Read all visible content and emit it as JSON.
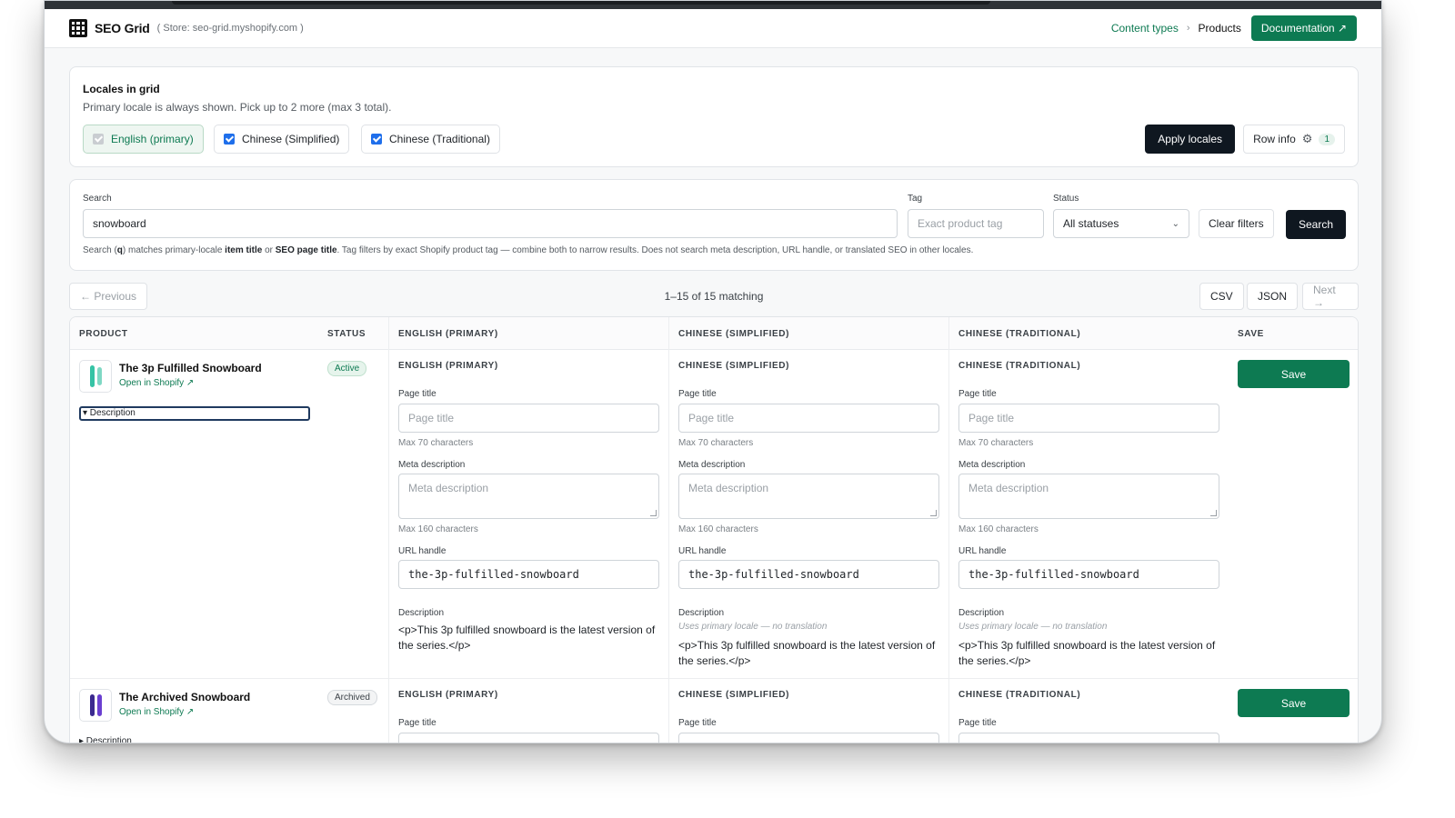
{
  "header": {
    "brand": "SEO Grid",
    "store": "( Store: seo-grid.myshopify.com )",
    "breadcrumb": {
      "link": "Content types",
      "separator": "›",
      "current": "Products"
    },
    "doc_button": "Documentation ↗"
  },
  "locales": {
    "title": "Locales in grid",
    "subtitle": "Primary locale is always shown. Pick up to 2 more (max 3 total).",
    "options": [
      {
        "label": "English (primary)",
        "checked": true,
        "disabled": true
      },
      {
        "label": "Chinese (Simplified)",
        "checked": true,
        "disabled": false
      },
      {
        "label": "Chinese (Traditional)",
        "checked": true,
        "disabled": false
      }
    ],
    "apply_button": "Apply locales",
    "row_info_button": "Row info",
    "row_info_count": "1"
  },
  "search": {
    "search_label": "Search",
    "search_value": "snowboard",
    "tag_label": "Tag",
    "tag_placeholder": "Exact product tag",
    "status_label": "Status",
    "status_value": "All statuses",
    "clear_button": "Clear filters",
    "search_button": "Search",
    "help_1": "Search (",
    "help_q": "q",
    "help_2": ") matches primary-locale ",
    "help_item_title": "item title",
    "help_3": " or ",
    "help_seo_title": "SEO page title",
    "help_4": ". Tag filters by exact Shopify product tag — combine both to narrow results. Does not search meta description, URL handle, or translated SEO in other locales."
  },
  "pager": {
    "previous": "← Previous",
    "summary": "1–15 of 15 matching",
    "csv": "CSV",
    "json": "JSON",
    "next": "Next →"
  },
  "table": {
    "headers": {
      "product": "PRODUCT",
      "status": "STATUS",
      "en": "ENGLISH (PRIMARY)",
      "zh_cn": "CHINESE (SIMPLIFIED)",
      "zh_tw": "CHINESE (TRADITIONAL)",
      "save": "SAVE"
    },
    "field_labels": {
      "page_title": "Page title",
      "page_title_placeholder": "Page title",
      "page_title_hint": "Max 70 characters",
      "meta_description": "Meta description",
      "meta_placeholder": "Meta description",
      "meta_hint": "Max 160 characters",
      "url_handle": "URL handle",
      "description": "Description",
      "fallback_note": "Uses primary locale — no translation"
    },
    "rows": [
      {
        "name": "The 3p Fulfilled Snowboard",
        "open_link": "Open in Shopify ↗",
        "status": "Active",
        "details_label": "▾ Description",
        "handle": "the-3p-fulfilled-snowboard",
        "description": "<p>This 3p fulfilled snowboard is the latest version of the series.</p>",
        "save": "Save"
      },
      {
        "name": "The Archived Snowboard",
        "open_link": "Open in Shopify ↗",
        "status": "Archived",
        "details_label": "▸ Description",
        "save": "Save"
      }
    ]
  },
  "colors": {
    "accent": "#0d7a52",
    "dark_button": "#0f1720",
    "checkbox": "#1f6feb"
  },
  "icons": [
    "grid-logo-icon",
    "chevron-right-icon",
    "external-link-icon",
    "gear-icon",
    "chevron-down-icon",
    "arrow-left-icon",
    "arrow-right-icon",
    "snowboard-thumbnail"
  ]
}
